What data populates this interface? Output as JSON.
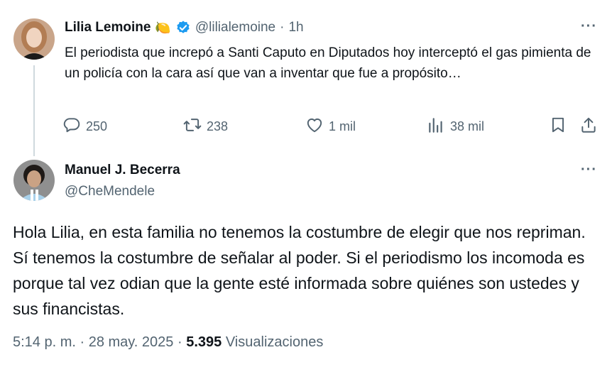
{
  "parent_tweet": {
    "author_name": "Lilia Lemoine",
    "emoji": "🍋",
    "handle": "@lilialemoine",
    "separator": "·",
    "time": "1h",
    "text": "El periodista que increpó a Santi Caputo en Diputados hoy interceptó el gas pimienta de un policía con la cara así que van a inventar que fue a propósito…",
    "replies": "250",
    "retweets": "238",
    "likes": "1 mil",
    "views": "38 mil"
  },
  "reply_tweet": {
    "author_name": "Manuel J. Becerra",
    "handle": "@CheMendele",
    "text": "Hola Lilia, en esta familia no tenemos la costumbre de elegir que nos repriman. Sí tenemos la costumbre de señalar al poder. Si el periodismo los incomoda es porque tal vez odian que la gente esté informada sobre quiénes son ustedes y sus financistas.",
    "time_date": "5:14 p. m. · 28 may. 2025 ·",
    "views_count": "5.395",
    "views_label": "Visualizaciones"
  },
  "icons": [
    "more-icon",
    "verified-icon",
    "reply-icon",
    "retweet-icon",
    "like-icon",
    "views-icon",
    "bookmark-icon",
    "share-icon"
  ],
  "colors": {
    "text": "#0f1419",
    "secondary": "#536471",
    "verified": "#1d9bf0",
    "thread_line": "#cfd9de"
  }
}
